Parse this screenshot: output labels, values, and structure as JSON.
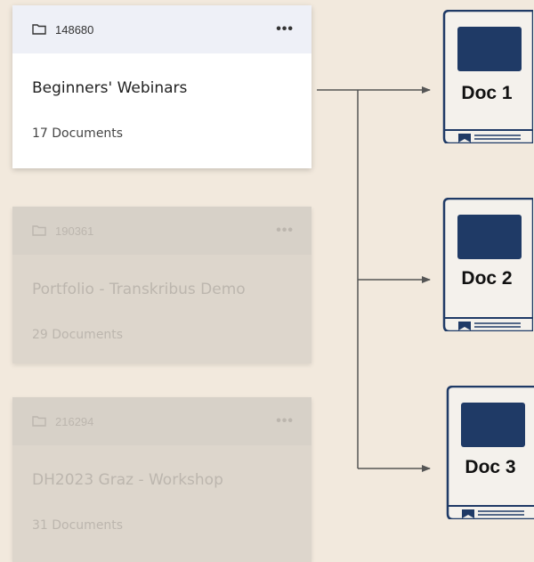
{
  "folders": [
    {
      "id": "148680",
      "title": "Beginners' Webinars",
      "count": "17 Documents",
      "more": "•••",
      "state": "active"
    },
    {
      "id": "190361",
      "title": "Portfolio - Transkribus Demo",
      "count": "29 Documents",
      "more": "•••",
      "state": "faded"
    },
    {
      "id": "216294",
      "title": "DH2023 Graz - Workshop",
      "count": "31 Documents",
      "more": "•••",
      "state": "faded"
    }
  ],
  "documents": [
    {
      "label": "Doc 1"
    },
    {
      "label": "Doc 2"
    },
    {
      "label": "Doc 3"
    }
  ],
  "icons": {
    "folder": "folder-icon",
    "more": "more-options-icon",
    "document": "book-icon"
  },
  "colors": {
    "background": "#f2e9dd",
    "card_header": "#eef0f7",
    "book_cover": "#1f3a66",
    "connector": "#555555"
  }
}
